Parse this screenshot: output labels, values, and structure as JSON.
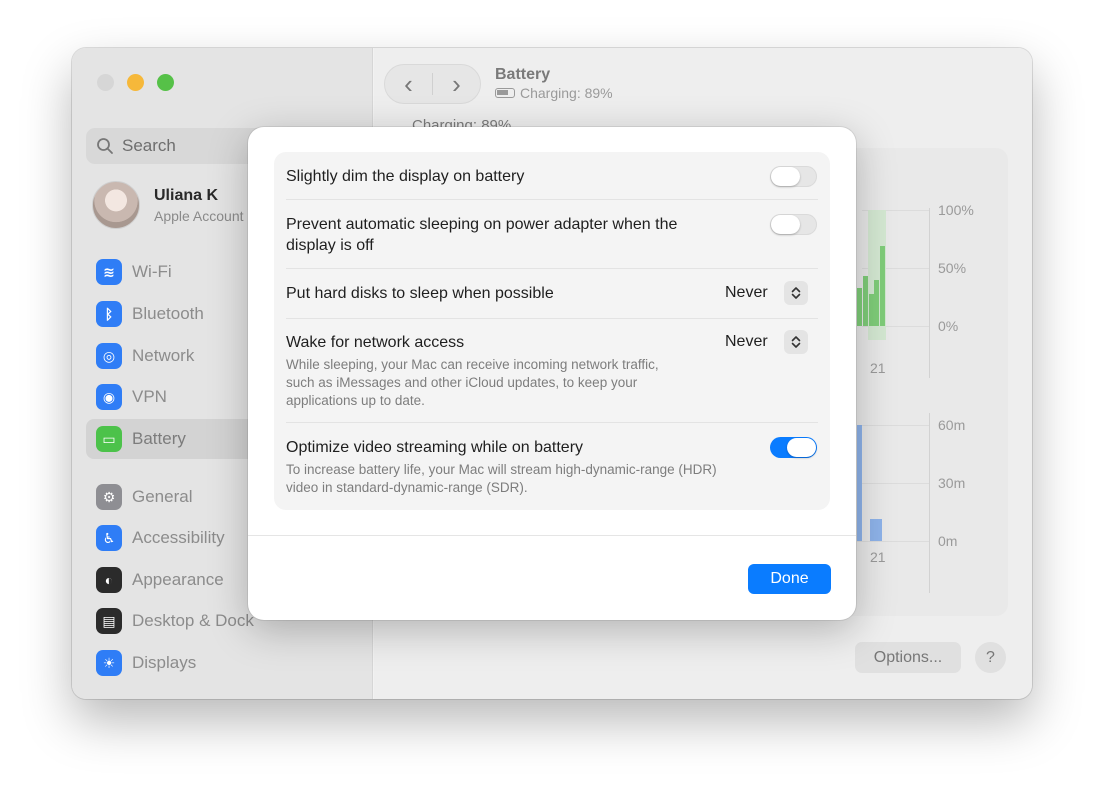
{
  "window": {
    "title": "Battery",
    "status": "Charging: 89%",
    "section_header": "Charging: 89%"
  },
  "sidebar": {
    "search_placeholder": "Search",
    "account": {
      "name": "Uliana K",
      "subtitle": "Apple Account"
    },
    "items": [
      {
        "label": "Wi-Fi",
        "icon": "wifi-icon",
        "color": "#2f7df6"
      },
      {
        "label": "Bluetooth",
        "icon": "bluetooth-icon",
        "color": "#2f7df6"
      },
      {
        "label": "Network",
        "icon": "globe-icon",
        "color": "#2f7df6"
      },
      {
        "label": "VPN",
        "icon": "vpn-globe-icon",
        "color": "#2f7df6"
      },
      {
        "label": "Battery",
        "icon": "battery-icon",
        "color": "#4cc24a",
        "selected": true
      },
      {
        "label": "General",
        "icon": "gear-icon",
        "color": "#8e8e93"
      },
      {
        "label": "Accessibility",
        "icon": "accessibility-icon",
        "color": "#2f7df6"
      },
      {
        "label": "Appearance",
        "icon": "appearance-icon",
        "color": "#2b2b2b"
      },
      {
        "label": "Desktop & Dock",
        "icon": "dock-icon",
        "color": "#2b2b2b"
      },
      {
        "label": "Displays",
        "icon": "sun-icon",
        "color": "#2f7df6"
      }
    ]
  },
  "charts": {
    "level": {
      "ticks": [
        "100%",
        "50%",
        "0%"
      ],
      "x_label": "21",
      "color": "#5fbf5a"
    },
    "usage": {
      "ticks": [
        "60m",
        "30m",
        "0m"
      ],
      "x_label": "21",
      "color": "#7aa6e6"
    }
  },
  "footer": {
    "options_label": "Options...",
    "help_label": "?"
  },
  "sheet": {
    "rows": [
      {
        "label": "Slightly dim the display on battery",
        "control": "toggle",
        "value": false
      },
      {
        "label": "Prevent automatic sleeping on power adapter when the display is off",
        "control": "toggle",
        "value": false
      },
      {
        "label": "Put hard disks to sleep when possible",
        "control": "popup",
        "value": "Never"
      },
      {
        "label": "Wake for network access",
        "control": "popup",
        "value": "Never",
        "description": "While sleeping, your Mac can receive incoming network traffic, such as iMessages and other iCloud updates, to keep your applications up to date."
      },
      {
        "label": "Optimize video streaming while on battery",
        "control": "toggle",
        "value": true,
        "description": "To increase battery life, your Mac will stream high-dynamic-range (HDR) video in standard-dynamic-range (SDR)."
      }
    ],
    "done_label": "Done",
    "accent": "#0a7cff"
  }
}
